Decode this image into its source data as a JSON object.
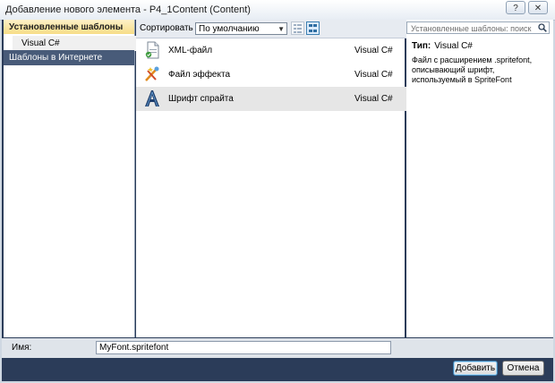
{
  "window": {
    "title": "Добавление нового элемента - P4_1Content (Content)",
    "help_symbol": "?",
    "close_symbol": "✕"
  },
  "left": {
    "installed_header": "Установленные шаблоны",
    "language_item": "Visual C#",
    "online_item": "Шаблоны в Интернете"
  },
  "toolbar": {
    "sort_label": "Сортировать по:",
    "sort_value": "По умолчанию"
  },
  "templates": [
    {
      "name": "XML-файл",
      "lang": "Visual C#",
      "icon": "xml-file-icon",
      "selected": false
    },
    {
      "name": "Файл эффекта",
      "lang": "Visual C#",
      "icon": "effect-file-icon",
      "selected": false
    },
    {
      "name": "Шрифт спрайта",
      "lang": "Visual C#",
      "icon": "sprite-font-icon",
      "selected": true
    }
  ],
  "details": {
    "search_placeholder": "Установленные шаблоны: поиск",
    "type_label": "Тип:",
    "type_value": "Visual C#",
    "description": "Файл с расширением .spritefont, описывающий шрифт, используемый в SpriteFont"
  },
  "name_field": {
    "label": "Имя:",
    "value": "MyFont.spritefont"
  },
  "buttons": {
    "add": "Добавить",
    "cancel": "Отмена"
  },
  "colors": {
    "frame": "#2b3c59",
    "header_highlight": "#f7dd87",
    "online_item_bg": "#485b79"
  }
}
